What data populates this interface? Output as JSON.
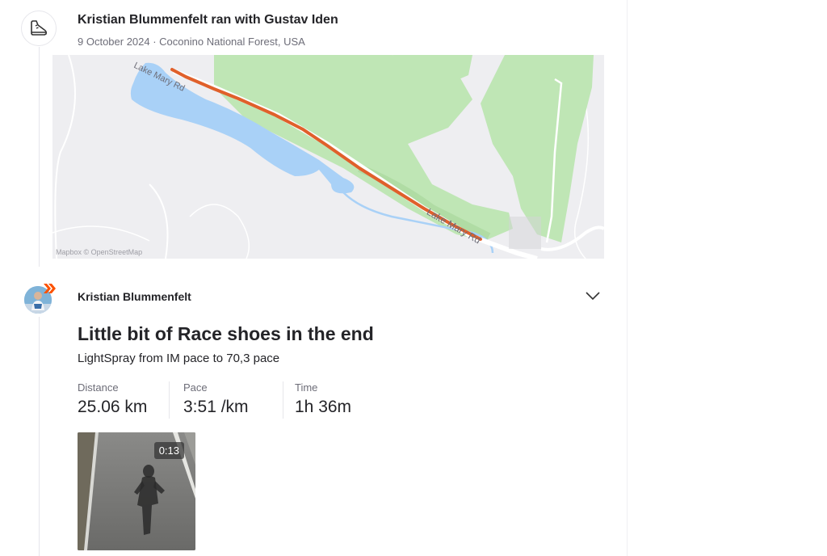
{
  "group": {
    "title": "Kristian Blummenfelt ran with Gustav Iden",
    "meta": "9 October 2024 · Coconino National Forest, USA",
    "icon": "running-shoe-icon"
  },
  "map": {
    "road_label_1": "Lake Mary Rd",
    "road_label_2": "Lake Mary Rd",
    "attribution": "Mapbox © OpenStreetMap",
    "route_color": "#e0602b",
    "water_color": "#a9d1f7",
    "forest_color": "#bfe6b5"
  },
  "activity": {
    "athlete": "Kristian Blummenfelt",
    "title": "Little bit of Race shoes in the end",
    "description": "LightSpray from IM pace to 70,3 pace",
    "stats": [
      {
        "label": "Distance",
        "value": "25.06 km"
      },
      {
        "label": "Pace",
        "value": "3:51 /km"
      },
      {
        "label": "Time",
        "value": "1h 36m"
      }
    ],
    "media": {
      "duration": "0:13"
    },
    "menu_icon": "chevron-down-icon"
  }
}
